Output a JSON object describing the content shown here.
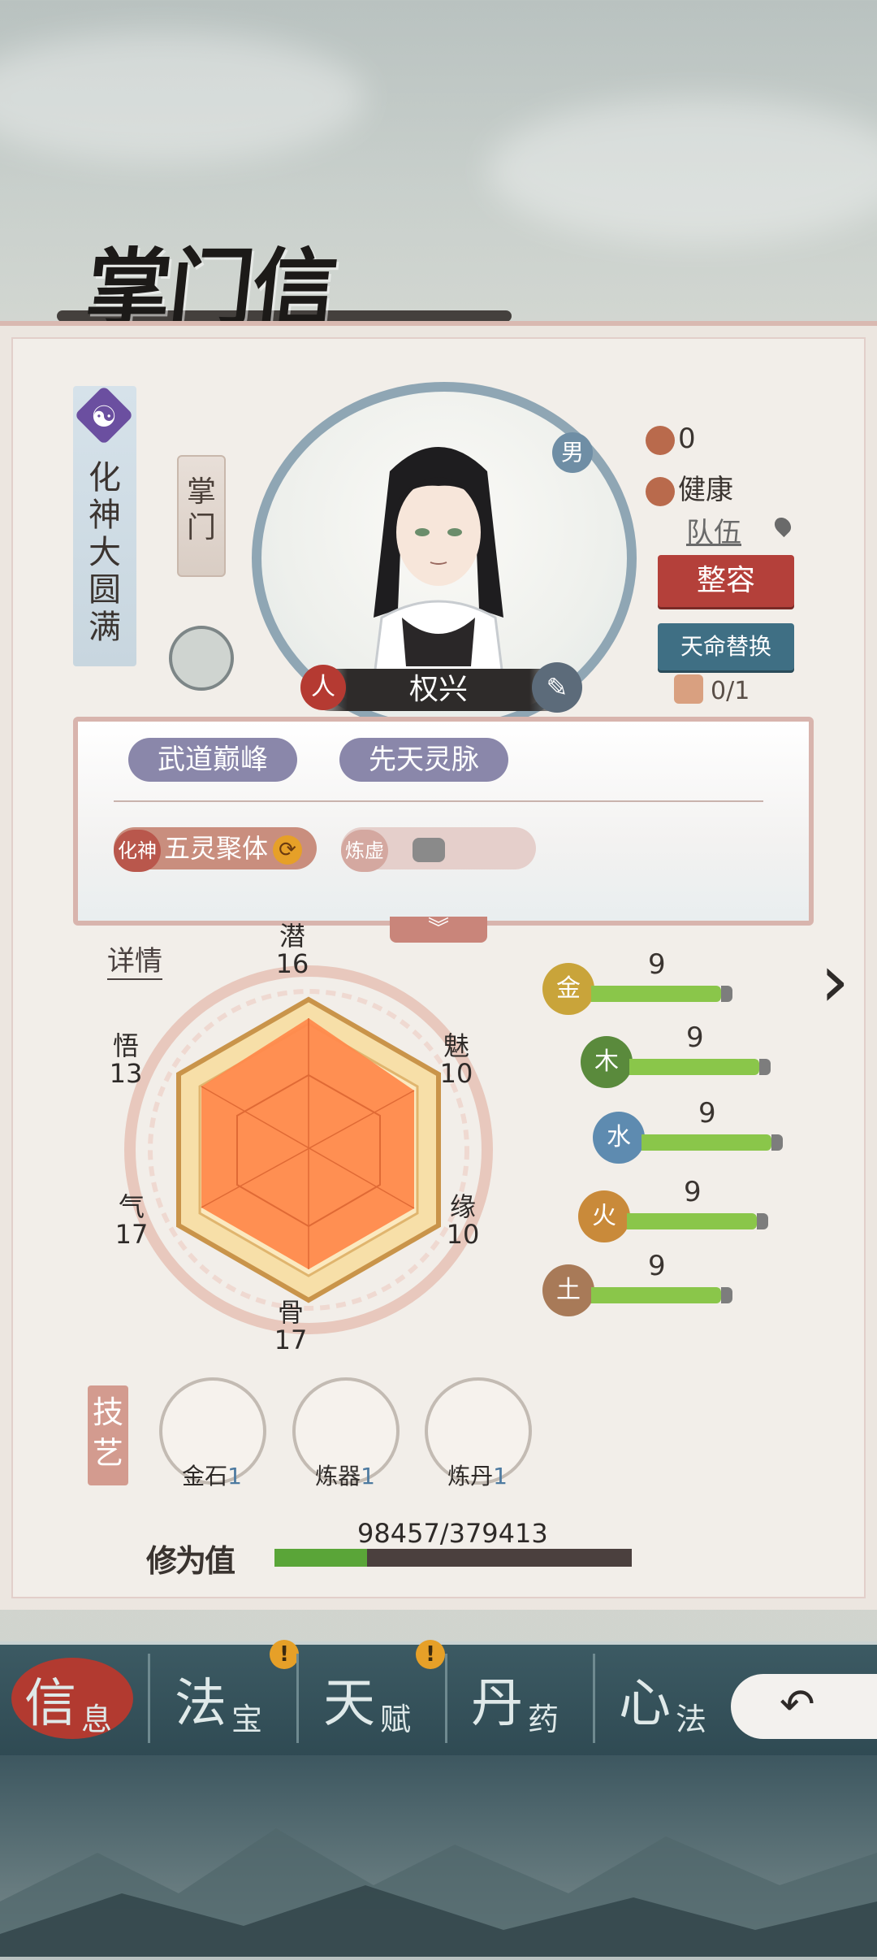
{
  "header": {
    "title": "掌门信息"
  },
  "character": {
    "rank": "化神大圆满",
    "role": "掌门",
    "gender": "男",
    "name": "权兴",
    "name_left_badge": "人",
    "stat_value": "0",
    "health": "健康",
    "team_label": "队伍",
    "restyle_button": "整容",
    "destiny_button": "天命替换",
    "scroll_count": "0/1"
  },
  "traits": {
    "tags": [
      "武道巅峰",
      "先天灵脉"
    ],
    "skills": [
      {
        "prefix": "化神",
        "label": "五灵聚体"
      },
      {
        "prefix": "炼虚",
        "label": ""
      }
    ],
    "expand_icon": "chevron-double-down-icon"
  },
  "attributes": {
    "details_link": "详情",
    "qian": {
      "label": "潜",
      "value": 16
    },
    "mei": {
      "label": "魅",
      "value": 10
    },
    "yuan": {
      "label": "缘",
      "value": 10
    },
    "gu": {
      "label": "骨",
      "value": 17
    },
    "qi": {
      "label": "气",
      "value": 17
    },
    "wu": {
      "label": "悟",
      "value": 13
    }
  },
  "elements": [
    {
      "name": "金",
      "value": 9,
      "color": "#c9a43a"
    },
    {
      "name": "木",
      "value": 9,
      "color": "#5a8a3c"
    },
    {
      "name": "水",
      "value": 9,
      "color": "#5e8bb0"
    },
    {
      "name": "火",
      "value": 9,
      "color": "#c98a3a"
    },
    {
      "name": "土",
      "value": 9,
      "color": "#a87a58"
    }
  ],
  "crafts": {
    "label": "技艺",
    "items": [
      {
        "name": "金石",
        "level": "1"
      },
      {
        "name": "炼器",
        "level": "1"
      },
      {
        "name": "炼丹",
        "level": "1"
      }
    ]
  },
  "cultivation": {
    "label": "修为值",
    "text": "98457/379413",
    "current": 98457,
    "max": 379413
  },
  "nav": {
    "tabs": [
      {
        "main": "信",
        "sub": "息",
        "active": true
      },
      {
        "main": "法",
        "sub": "宝",
        "badge": "!"
      },
      {
        "main": "天",
        "sub": "赋",
        "badge": "!"
      },
      {
        "main": "丹",
        "sub": "药"
      },
      {
        "main": "心",
        "sub": "法"
      }
    ],
    "back_icon": "back-arrow-icon"
  }
}
